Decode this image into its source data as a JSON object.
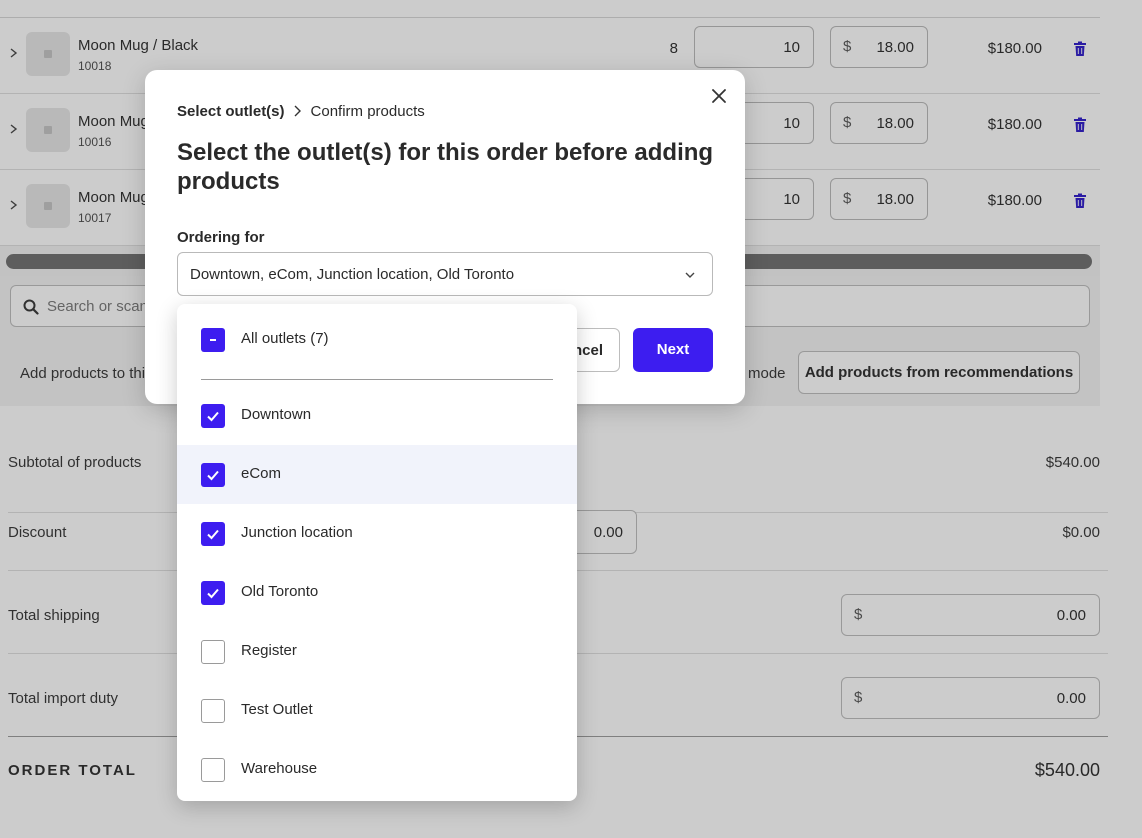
{
  "colors": {
    "accent": "#3d1df0",
    "trash": "#2b17c9",
    "highlight_row": "#f1f3fb"
  },
  "products": [
    {
      "name": "Moon Mug / Black",
      "sku": "10018",
      "stock": "8",
      "qty": "10",
      "currency": "$",
      "cost": "18.00",
      "total": "$180.00"
    },
    {
      "name": "Moon Mug",
      "sku": "10016",
      "stock": "",
      "qty": "10",
      "currency": "$",
      "cost": "18.00",
      "total": "$180.00"
    },
    {
      "name": "Moon Mug",
      "sku": "10017",
      "stock": "",
      "qty": "10",
      "currency": "$",
      "cost": "18.00",
      "total": "$180.00"
    }
  ],
  "search": {
    "placeholder": "Search or scan t"
  },
  "add_bar": {
    "text": "Add products to thi",
    "mode_text": "mode",
    "recommend_button": "Add products from recommendations"
  },
  "totals": {
    "subtotal_label": "Subtotal of products",
    "subtotal_value": "$540.00",
    "discount_label": "Discount",
    "discount_input": "0.00",
    "discount_value": "$0.00",
    "shipping_label": "Total shipping",
    "shipping_currency": "$",
    "shipping_value": "0.00",
    "duty_label": "Total import duty",
    "duty_currency": "$",
    "duty_value": "0.00",
    "order_total_label": "ORDER TOTAL",
    "order_total_value": "$540.00"
  },
  "modal": {
    "breadcrumb": [
      "Select outlet(s)",
      "Confirm products"
    ],
    "title": "Select the outlet(s) for this order before adding products",
    "field_label": "Ordering for",
    "select_value": "Downtown, eCom, Junction location, Old Toronto",
    "cancel_label": "ncel",
    "next_label": "Next"
  },
  "dropdown": {
    "all_label": "All outlets (7)",
    "all_state": "indeterminate",
    "options": [
      {
        "label": "Downtown",
        "checked": true
      },
      {
        "label": "eCom",
        "checked": true,
        "highlighted": true
      },
      {
        "label": "Junction location",
        "checked": true
      },
      {
        "label": "Old Toronto",
        "checked": true
      },
      {
        "label": "Register",
        "checked": false
      },
      {
        "label": "Test Outlet",
        "checked": false
      },
      {
        "label": "Warehouse",
        "checked": false
      }
    ]
  }
}
